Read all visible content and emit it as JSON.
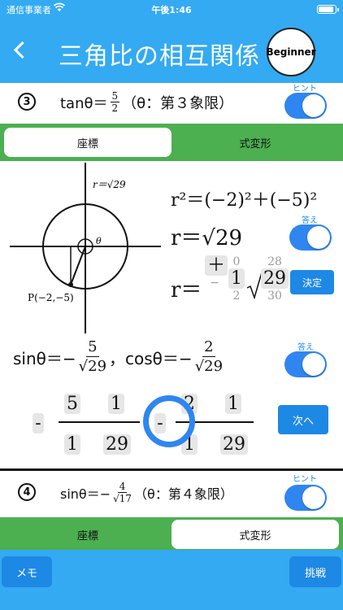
{
  "status": {
    "carrier": "通信事業者",
    "time": "午後1:46"
  },
  "header": {
    "title": "三角比の相互関係",
    "badge": "Beginner"
  },
  "problem3": {
    "number": "3",
    "expr_prefix": "tanθ＝",
    "num": "5",
    "den": "2",
    "expr_suffix": "（θ：第３象限）",
    "hint_label": "ヒント"
  },
  "tabs_top": {
    "coords": "座標",
    "formula": "式変形"
  },
  "diagram": {
    "r_label": "r＝√29",
    "theta": "θ",
    "point": "P(−2,−5)"
  },
  "work": {
    "line1": "r²＝(−2)²＋(−5)²",
    "line2": "r＝√29",
    "answer_label": "答え",
    "line3_prefix": "r＝",
    "picker_sign": {
      "top": "",
      "cur": "＋",
      "bot": "−"
    },
    "picker_a": {
      "top": "0",
      "cur": "1",
      "bot": "2"
    },
    "picker_b": {
      "top": "28",
      "cur": "29",
      "bot": "30"
    },
    "decide": "決定",
    "sin_prefix": "sinθ＝−",
    "sin_num": "5",
    "sin_den": "√29",
    "cos_prefix": "，cosθ＝−",
    "cos_num": "2",
    "cos_den": "√29",
    "answer_label2": "答え",
    "next": "次へ",
    "f1": {
      "sign": "-",
      "num": "5",
      "num_root": "1",
      "den": "1",
      "den_root": "29"
    },
    "f2": {
      "sign": "-",
      "num": "2",
      "num_root": "1",
      "den": "1",
      "den_root": "29"
    }
  },
  "problem4": {
    "number": "4",
    "expr_prefix": "sinθ＝−",
    "num": "4",
    "den": "√17",
    "expr_suffix": "（θ：第４象限）",
    "hint_label": "ヒント"
  },
  "tabs_bottom": {
    "coords": "座標",
    "formula": "式変形"
  },
  "footer": {
    "memo": "メモ",
    "challenge": "挑戦"
  }
}
